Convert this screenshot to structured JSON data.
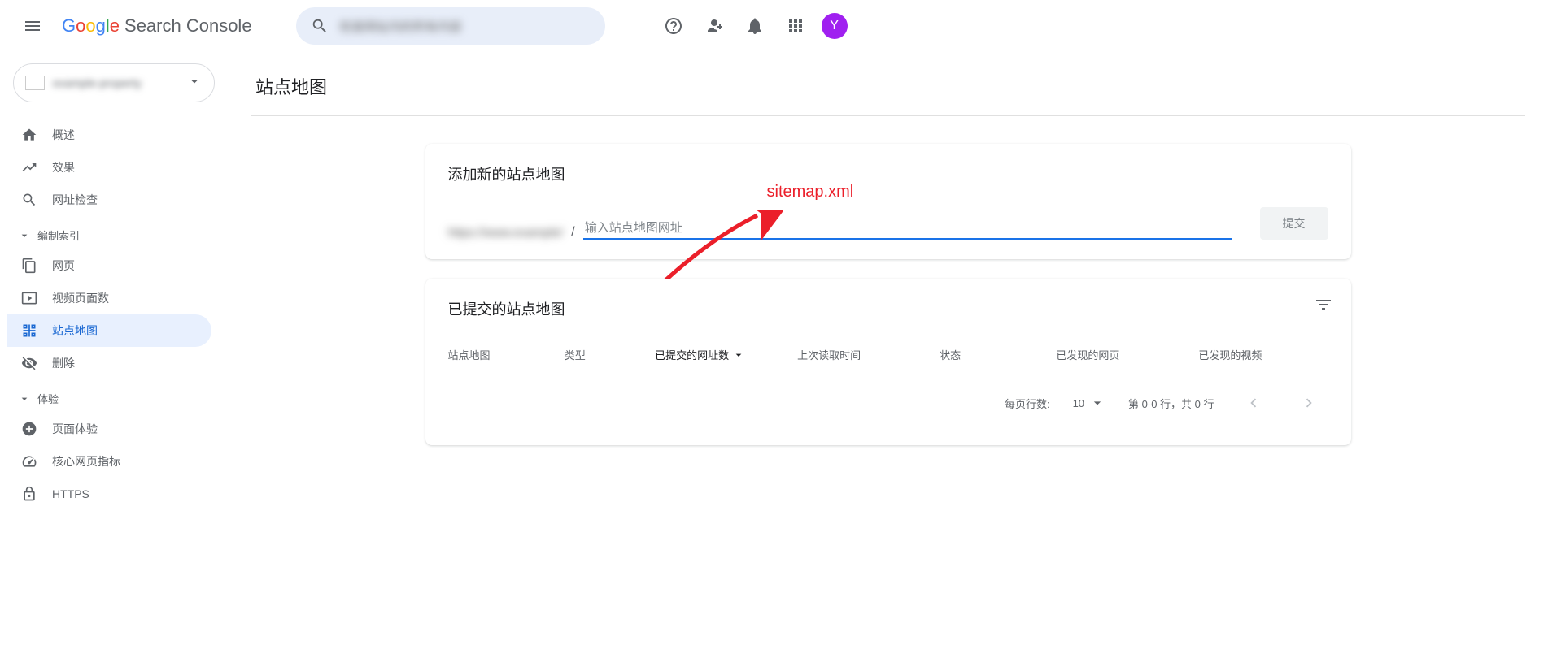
{
  "header": {
    "product": "Search Console",
    "search_placeholder": "检查网址内的所有内容",
    "avatar_initial": "Y"
  },
  "property": {
    "name": "example-property"
  },
  "sidebar": {
    "items": {
      "overview": "概述",
      "performance": "效果",
      "inspect": "网址检查"
    },
    "section_index": "编制索引",
    "index_items": {
      "pages": "网页",
      "video": "视频页面数",
      "sitemap": "站点地图",
      "removal": "删除"
    },
    "section_experience": "体验",
    "exp_items": {
      "page_exp": "页面体验",
      "cwv": "核心网页指标",
      "https": "HTTPS"
    }
  },
  "page": {
    "title": "站点地图"
  },
  "add_card": {
    "title": "添加新的站点地图",
    "prefix": "https://www.example/",
    "placeholder": "输入站点地图网址",
    "submit": "提交"
  },
  "annotation": "sitemap.xml",
  "list_card": {
    "title": "已提交的站点地图",
    "cols": {
      "sitemap": "站点地图",
      "type": "类型",
      "submitted": "已提交的网址数",
      "last_read": "上次读取时间",
      "status": "状态",
      "pages": "已发现的网页",
      "videos": "已发现的视频"
    },
    "rows_label": "每页行数:",
    "rows_value": "10",
    "range": "第 0-0 行，共 0 行"
  }
}
